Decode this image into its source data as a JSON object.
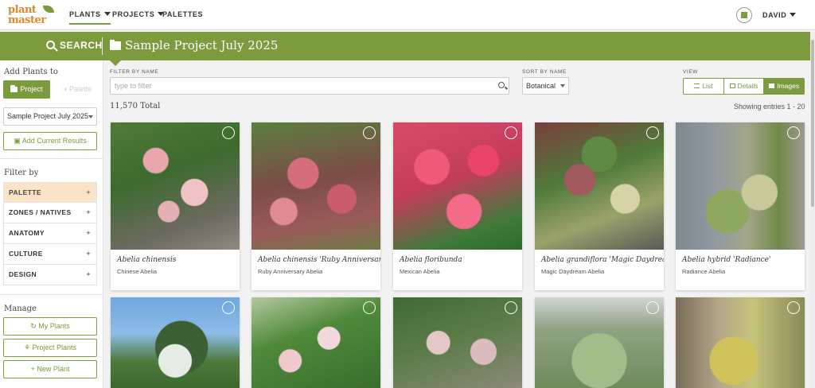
{
  "brand": {
    "line1": "plant",
    "line2": "master"
  },
  "nav": {
    "plants": "PLANTS",
    "projects": "PROJECTS",
    "palettes": "PALETTES",
    "user": "DAVID"
  },
  "header": {
    "search": "SEARCH",
    "project_title": "Sample Project July 2025"
  },
  "sidebar": {
    "add_heading": "Add Plants to",
    "project_btn": "Project",
    "palette_btn": "Palette",
    "selected_project": "Sample Project July 2025",
    "add_current": "Add Current Results",
    "filter_heading": "Filter by",
    "filters": [
      {
        "label": "PALETTE"
      },
      {
        "label": "ZONES / NATIVES"
      },
      {
        "label": "ANATOMY"
      },
      {
        "label": "CULTURE"
      },
      {
        "label": "DESIGN"
      }
    ],
    "plus": "+",
    "manage_heading": "Manage",
    "my_plants": "My Plants",
    "project_plants": "Project Plants",
    "new_plant": "New Plant"
  },
  "toolbar": {
    "filter_label": "FILTER BY NAME",
    "filter_placeholder": "type to filter",
    "sort_label": "SORT BY NAME",
    "sort_value": "Botanical",
    "view_label": "VIEW",
    "view_list": "List",
    "view_details": "Details",
    "view_images": "Images",
    "total": "11,570 Total",
    "showing": "Showing entries 1 - 20"
  },
  "cards": [
    {
      "sci": "Abelia chinensis",
      "common": "Chinese Abelia"
    },
    {
      "sci": "Abelia chinensis 'Ruby Anniversary'",
      "common": "Ruby Anniversary Abelia"
    },
    {
      "sci": "Abelia floribunda",
      "common": "Mexican Abelia"
    },
    {
      "sci": "Abelia grandiflora 'Magic Daydream'",
      "common": "Magic Daydream Abelia"
    },
    {
      "sci": "Abelia hybrid 'Radiance'",
      "common": "Radiance Abelia"
    },
    {
      "sci": "",
      "common": ""
    },
    {
      "sci": "",
      "common": ""
    },
    {
      "sci": "",
      "common": ""
    },
    {
      "sci": "",
      "common": ""
    },
    {
      "sci": "",
      "common": ""
    }
  ],
  "colors": {
    "accent": "#7c9a3e",
    "logo": "#d88a2c",
    "active_filter": "#fae3c6"
  }
}
